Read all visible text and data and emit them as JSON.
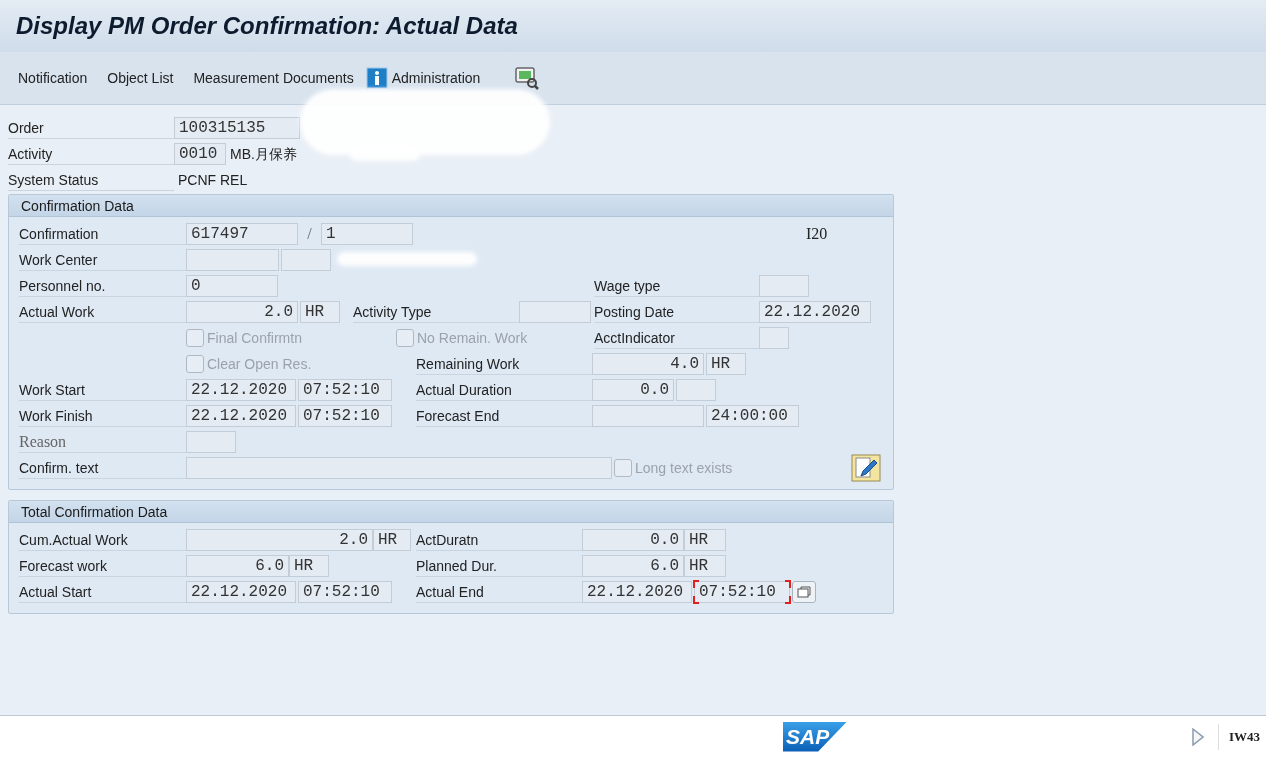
{
  "title": "Display PM Order Confirmation: Actual Data",
  "toolbar": [
    {
      "kind": "text",
      "label": "Notification"
    },
    {
      "kind": "text",
      "label": "Object List"
    },
    {
      "kind": "text",
      "label": "Measurement Documents"
    },
    {
      "kind": "info",
      "label": "Administration"
    },
    {
      "kind": "icon"
    }
  ],
  "header": {
    "order": {
      "label": "Order",
      "value": "100315135"
    },
    "activity": {
      "label": "Activity",
      "value": "0010",
      "text": "MB.月保养"
    },
    "system_status": {
      "label": "System Status",
      "value": "PCNF REL"
    }
  },
  "confirmation_data": {
    "title": "Confirmation Data",
    "confirmation": {
      "label": "Confirmation",
      "value": "617497",
      "separator": "/",
      "counter": "1"
    },
    "code": "I20",
    "work_center": {
      "label": "Work Center"
    },
    "personnel_no": {
      "label": "Personnel no.",
      "value": "0"
    },
    "wage_type": {
      "label": "Wage type"
    },
    "actual_work": {
      "label": "Actual Work",
      "value": "2.0",
      "unit": "HR"
    },
    "activity_type": {
      "label": "Activity Type"
    },
    "posting_date": {
      "label": "Posting Date",
      "value": "22.12.2020"
    },
    "final_confirmation": {
      "label": "Final Confirmtn",
      "checked": false,
      "disabled": true
    },
    "no_remaining_work": {
      "label": "No Remain. Work",
      "checked": false,
      "disabled": true
    },
    "acct_indicator": {
      "label": "AcctIndicator"
    },
    "clear_open_res": {
      "label": "Clear Open Res.",
      "checked": false,
      "disabled": true
    },
    "remaining_work": {
      "label": "Remaining Work",
      "value": "4.0",
      "unit": "HR"
    },
    "work_start": {
      "label": "Work Start",
      "date": "22.12.2020",
      "time": "07:52:10"
    },
    "actual_duration": {
      "label": "Actual Duration",
      "value": "0.0"
    },
    "work_finish": {
      "label": "Work Finish",
      "date": "22.12.2020",
      "time": "07:52:10"
    },
    "forecast_end": {
      "label": "Forecast End",
      "time": "24:00:00"
    },
    "reason": {
      "label": "Reason"
    },
    "confirm_text": {
      "label": "Confirm. text"
    },
    "long_text_exists": {
      "label": "Long text exists",
      "checked": false,
      "disabled": true
    }
  },
  "total_confirmation_data": {
    "title": "Total Confirmation Data",
    "cum_actual_work": {
      "label": "Cum.Actual Work",
      "value": "2.0",
      "unit": "HR"
    },
    "act_duration": {
      "label": "ActDuratn",
      "value": "0.0",
      "unit": "HR"
    },
    "forecast_work": {
      "label": "Forecast work",
      "value": "6.0",
      "unit": "HR"
    },
    "planned_duration": {
      "label": "Planned Dur.",
      "value": "6.0",
      "unit": "HR"
    },
    "actual_start": {
      "label": "Actual Start",
      "date": "22.12.2020",
      "time": "07:52:10"
    },
    "actual_end": {
      "label": "Actual End",
      "date": "22.12.2020",
      "time": "07:52:10",
      "focused": true
    }
  },
  "status_bar": {
    "logo": "SAP",
    "transaction": "IW43"
  }
}
